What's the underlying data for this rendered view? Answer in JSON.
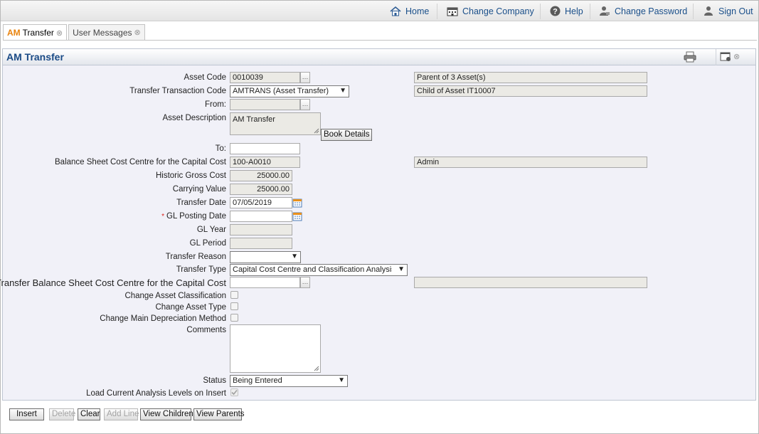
{
  "nav": {
    "home": "Home",
    "change_company": "Change Company",
    "help": "Help",
    "change_password": "Change Password",
    "sign_out": "Sign Out"
  },
  "tabs": [
    {
      "prefix": "AM",
      "label": "Transfer",
      "active": true
    },
    {
      "prefix": "",
      "label": "User Messages",
      "active": false
    }
  ],
  "panel": {
    "title": "AM Transfer"
  },
  "form": {
    "asset_code": {
      "label": "Asset Code",
      "value": "0010039",
      "info": "Parent of 3 Asset(s)"
    },
    "transfer_transaction_code": {
      "label": "Transfer Transaction Code",
      "value": "AMTRANS (Asset Transfer)",
      "info": "Child of Asset IT10007"
    },
    "from": {
      "label": "From:",
      "value": ""
    },
    "asset_description": {
      "label": "Asset Description",
      "value": "AM Transfer",
      "book_details": "Book Details"
    },
    "to": {
      "label": "To:",
      "value": ""
    },
    "balance_sheet_cc": {
      "label": "Balance Sheet Cost Centre for the Capital Cost",
      "value": "100-A0010",
      "info": "Admin"
    },
    "historic_gross_cost": {
      "label": "Historic Gross Cost",
      "value": "25000.00"
    },
    "carrying_value": {
      "label": "Carrying Value",
      "value": "25000.00"
    },
    "transfer_date": {
      "label": "Transfer Date",
      "value": "07/05/2019"
    },
    "gl_posting_date": {
      "label": "GL Posting Date",
      "value": "",
      "required_mark": "*"
    },
    "gl_year": {
      "label": "GL Year",
      "value": ""
    },
    "gl_period": {
      "label": "GL Period",
      "value": ""
    },
    "transfer_reason": {
      "label": "Transfer Reason",
      "value": ""
    },
    "transfer_type": {
      "label": "Transfer Type",
      "value": "Capital Cost Centre and Classification Analysis"
    },
    "transfer_bs_cc": {
      "label": "Transfer Balance Sheet Cost Centre for the Capital Cost",
      "value": "",
      "info": ""
    },
    "change_asset_classification": {
      "label": "Change Asset Classification",
      "checked": false
    },
    "change_asset_type": {
      "label": "Change Asset Type",
      "checked": false
    },
    "change_main_depreciation_method": {
      "label": "Change Main Depreciation Method",
      "checked": false
    },
    "comments": {
      "label": "Comments",
      "value": ""
    },
    "status": {
      "label": "Status",
      "value": "Being Entered"
    },
    "load_current_analysis": {
      "label": "Load Current Analysis Levels on Insert",
      "checked": true
    }
  },
  "buttons": {
    "insert": "Insert",
    "delete": "Delete",
    "clear": "Clear",
    "add_line": "Add Line",
    "view_children": "View Children",
    "view_parents": "View Parents"
  },
  "colors": {
    "nav_link": "#1a4f8a",
    "title": "#1a4a86",
    "tab_prefix": "#e8820c",
    "required": "#d9231d",
    "panel_bg": "#f1f1f8",
    "readonly_field": "#ebeae5"
  }
}
